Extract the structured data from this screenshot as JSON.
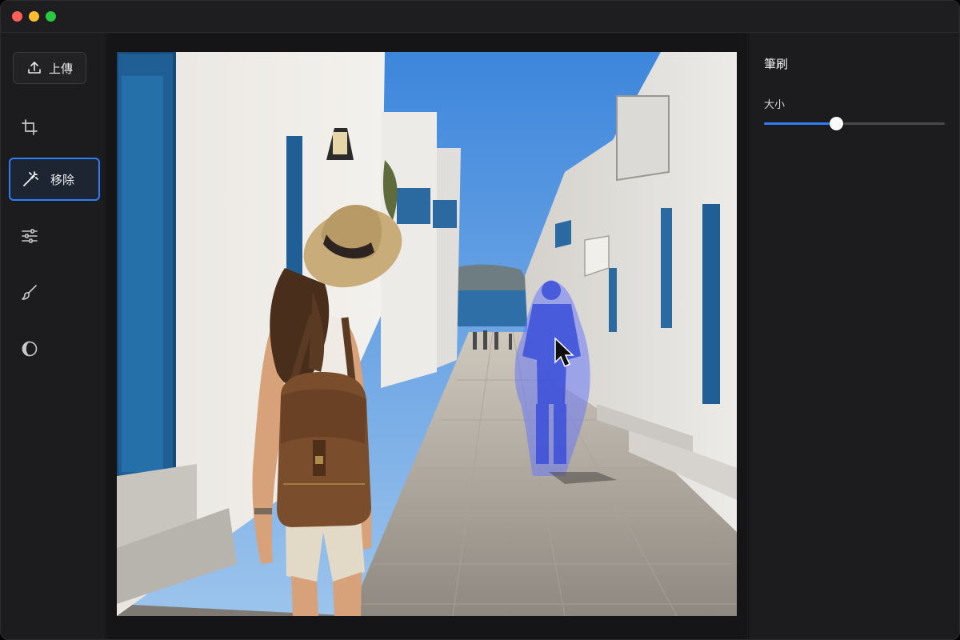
{
  "toolbar": {
    "upload_label": "上傳",
    "remove_label": "移除",
    "tools": [
      {
        "icon": "crop-icon"
      },
      {
        "icon": "magic-wand-icon",
        "active": true
      },
      {
        "icon": "sliders-icon"
      },
      {
        "icon": "brush-icon"
      },
      {
        "icon": "contrast-icon"
      }
    ]
  },
  "panel": {
    "title": "筆刷",
    "size_label": "大小",
    "size_value": 0.4
  },
  "colors": {
    "accent": "#2f7df6",
    "mask": "#4a5cf0"
  },
  "canvas": {
    "image": "street-photo",
    "mask_overlay": "person-mask",
    "cursor": "arrow-cursor"
  }
}
